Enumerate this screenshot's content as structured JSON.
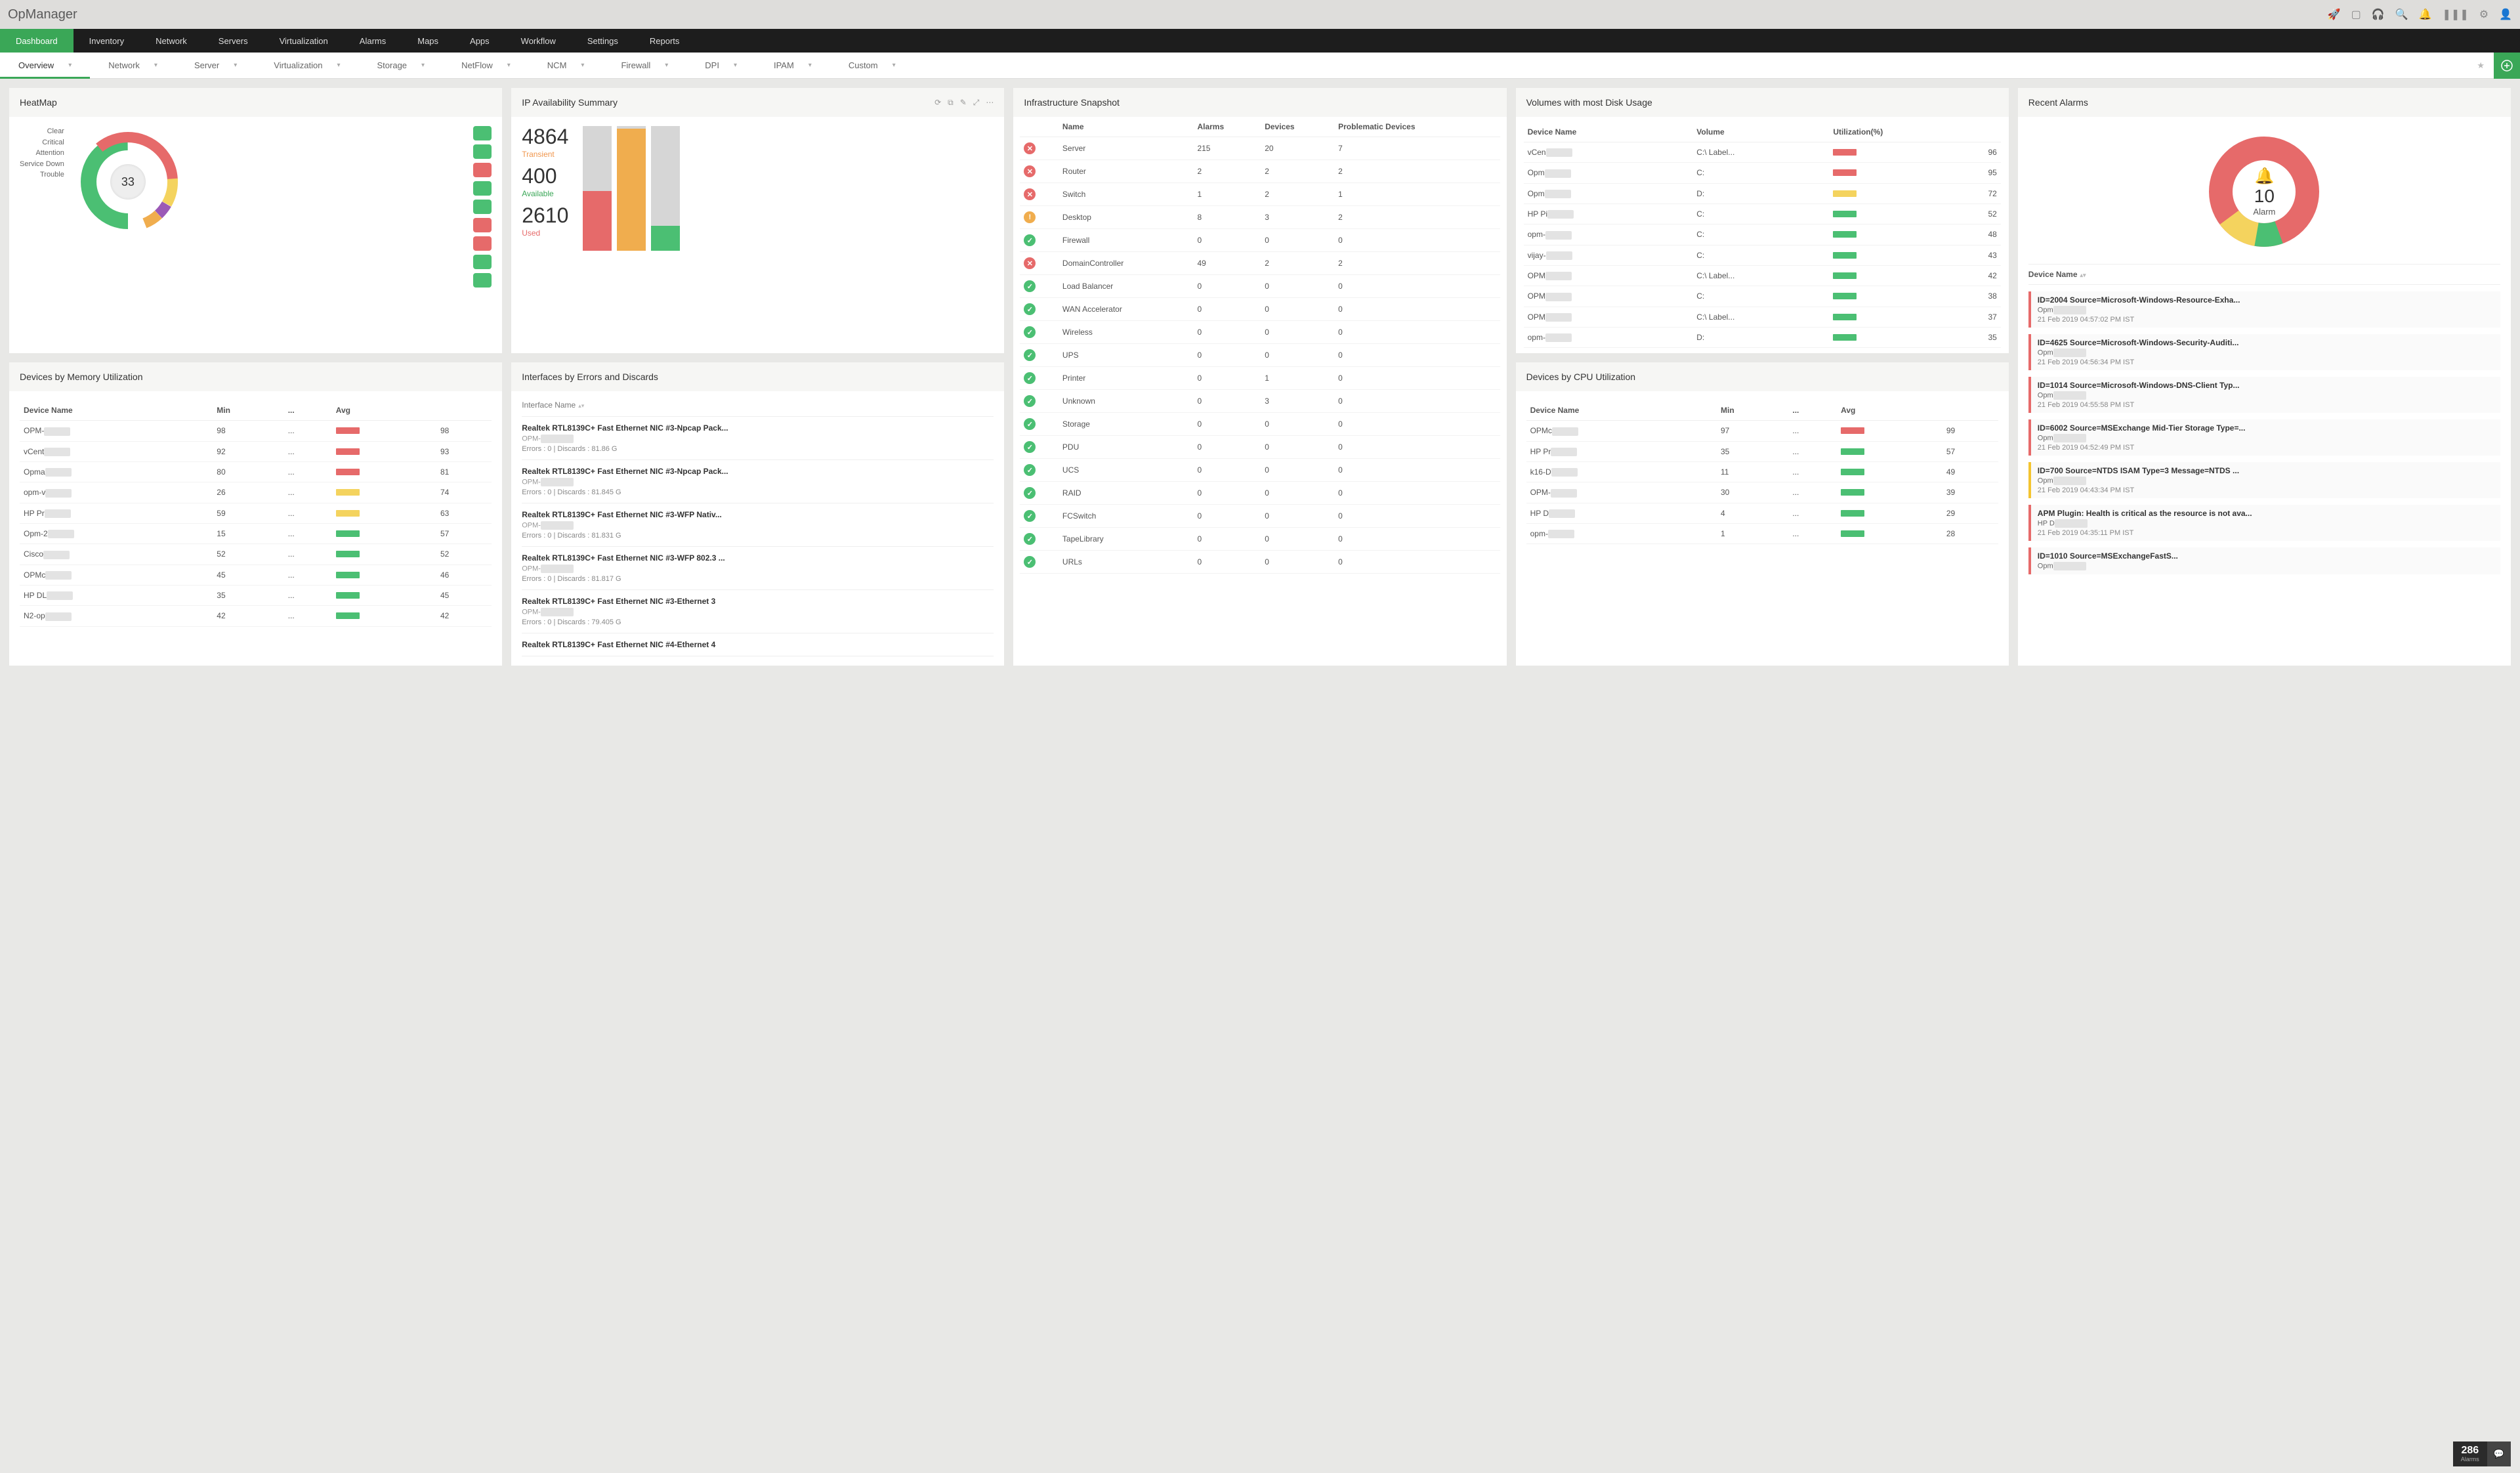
{
  "brand": "OpManager",
  "topIcons": [
    "rocket",
    "presentation",
    "headset",
    "search",
    "bell",
    "barcode",
    "gear",
    "user"
  ],
  "mainnav": [
    "Dashboard",
    "Inventory",
    "Network",
    "Servers",
    "Virtualization",
    "Alarms",
    "Maps",
    "Apps",
    "Workflow",
    "Settings",
    "Reports"
  ],
  "subnav": [
    "Overview",
    "Network",
    "Server",
    "Virtualization",
    "Storage",
    "NetFlow",
    "NCM",
    "Firewall",
    "DPI",
    "IPAM",
    "Custom"
  ],
  "heatmap": {
    "title": "HeatMap",
    "legend": [
      "Clear",
      "Critical",
      "Attention",
      "Service Down",
      "Trouble"
    ],
    "center": "33",
    "tileColors": [
      "g",
      "g",
      "r",
      "g",
      "g",
      "r",
      "r",
      "g",
      "g"
    ]
  },
  "ipAvail": {
    "title": "IP Availability Summary",
    "stats": [
      {
        "value": "4864",
        "label": "Transient",
        "cls": "orange-t"
      },
      {
        "value": "400",
        "label": "Available",
        "cls": "green-t"
      },
      {
        "value": "2610",
        "label": "Used",
        "cls": "red-t"
      }
    ],
    "bars": [
      {
        "fill": 48,
        "color": "#e66a6a"
      },
      {
        "fill": 98,
        "color": "#f0ad4e"
      },
      {
        "fill": 20,
        "color": "#4bbf73"
      }
    ]
  },
  "chart_data": [
    {
      "type": "pie",
      "title": "HeatMap",
      "categories": [
        "Clear",
        "Critical",
        "Attention",
        "Service Down",
        "Trouble"
      ],
      "center_value": 33,
      "notes": "Donut shows device status distribution; exact slice counts not labeled."
    },
    {
      "type": "bar",
      "title": "IP Availability Summary",
      "categories": [
        "Used",
        "Transient",
        "Available"
      ],
      "values": [
        2610,
        4864,
        400
      ],
      "colors": [
        "#e66a6a",
        "#f0ad4e",
        "#4bbf73"
      ]
    },
    {
      "type": "pie",
      "title": "Recent Alarms",
      "center_value": 10,
      "center_label": "Alarm",
      "notes": "Donut of alarm severities; majority red, small green and yellow slices."
    }
  ],
  "memUtil": {
    "title": "Devices by Memory Utilization",
    "headers": [
      "Device Name",
      "Min",
      "...",
      "Avg"
    ],
    "rows": [
      {
        "name": "OPM-",
        "min": "98",
        "avg": "98",
        "color": "#e66a6a"
      },
      {
        "name": "vCent",
        "min": "92",
        "avg": "93",
        "color": "#e66a6a"
      },
      {
        "name": "Opma",
        "min": "80",
        "avg": "81",
        "color": "#e66a6a"
      },
      {
        "name": "opm-v",
        "min": "26",
        "avg": "74",
        "color": "#f4d35e"
      },
      {
        "name": "HP Pr",
        "min": "59",
        "avg": "63",
        "color": "#f4d35e"
      },
      {
        "name": "Opm-2",
        "min": "15",
        "avg": "57",
        "color": "#4bbf73"
      },
      {
        "name": "Cisco",
        "min": "52",
        "avg": "52",
        "color": "#4bbf73"
      },
      {
        "name": "OPMc",
        "min": "45",
        "avg": "46",
        "color": "#4bbf73"
      },
      {
        "name": "HP DL",
        "min": "35",
        "avg": "45",
        "color": "#4bbf73"
      },
      {
        "name": "N2-op",
        "min": "42",
        "avg": "42",
        "color": "#4bbf73"
      }
    ]
  },
  "interfaces": {
    "title": "Interfaces by Errors and Discards",
    "header": "Interface Name",
    "items": [
      {
        "t": "Realtek RTL8139C+ Fast Ethernet NIC #3-Npcap Pack...",
        "d": "OPM-",
        "s": "Errors : 0 | Discards : 81.86 G"
      },
      {
        "t": "Realtek RTL8139C+ Fast Ethernet NIC #3-Npcap Pack...",
        "d": "OPM-",
        "s": "Errors : 0 | Discards : 81.845 G"
      },
      {
        "t": "Realtek RTL8139C+ Fast Ethernet NIC #3-WFP Nativ...",
        "d": "OPM-",
        "s": "Errors : 0 | Discards : 81.831 G"
      },
      {
        "t": "Realtek RTL8139C+ Fast Ethernet NIC #3-WFP 802.3 ...",
        "d": "OPM-",
        "s": "Errors : 0 | Discards : 81.817 G"
      },
      {
        "t": "Realtek RTL8139C+ Fast Ethernet NIC #3-Ethernet 3",
        "d": "OPM-",
        "s": "Errors : 0 | Discards : 79.405 G"
      },
      {
        "t": "Realtek RTL8139C+ Fast Ethernet NIC #4-Ethernet 4",
        "d": "",
        "s": ""
      }
    ]
  },
  "infra": {
    "title": "Infrastructure Snapshot",
    "headers": [
      "",
      "Name",
      "Alarms",
      "Devices",
      "Problematic Devices"
    ],
    "rows": [
      {
        "st": "red",
        "name": "Server",
        "a": "215",
        "d": "20",
        "p": "7"
      },
      {
        "st": "red",
        "name": "Router",
        "a": "2",
        "d": "2",
        "p": "2"
      },
      {
        "st": "red",
        "name": "Switch",
        "a": "1",
        "d": "2",
        "p": "1"
      },
      {
        "st": "orange",
        "name": "Desktop",
        "a": "8",
        "d": "3",
        "p": "2"
      },
      {
        "st": "green",
        "name": "Firewall",
        "a": "0",
        "d": "0",
        "p": "0"
      },
      {
        "st": "red",
        "name": "DomainController",
        "a": "49",
        "d": "2",
        "p": "2"
      },
      {
        "st": "green",
        "name": "Load Balancer",
        "a": "0",
        "d": "0",
        "p": "0"
      },
      {
        "st": "green",
        "name": "WAN Accelerator",
        "a": "0",
        "d": "0",
        "p": "0"
      },
      {
        "st": "green",
        "name": "Wireless",
        "a": "0",
        "d": "0",
        "p": "0"
      },
      {
        "st": "green",
        "name": "UPS",
        "a": "0",
        "d": "0",
        "p": "0"
      },
      {
        "st": "green",
        "name": "Printer",
        "a": "0",
        "d": "1",
        "p": "0"
      },
      {
        "st": "green",
        "name": "Unknown",
        "a": "0",
        "d": "3",
        "p": "0"
      },
      {
        "st": "green",
        "name": "Storage",
        "a": "0",
        "d": "0",
        "p": "0"
      },
      {
        "st": "green",
        "name": "PDU",
        "a": "0",
        "d": "0",
        "p": "0"
      },
      {
        "st": "green",
        "name": "UCS",
        "a": "0",
        "d": "0",
        "p": "0"
      },
      {
        "st": "green",
        "name": "RAID",
        "a": "0",
        "d": "0",
        "p": "0"
      },
      {
        "st": "green",
        "name": "FCSwitch",
        "a": "0",
        "d": "0",
        "p": "0"
      },
      {
        "st": "green",
        "name": "TapeLibrary",
        "a": "0",
        "d": "0",
        "p": "0"
      },
      {
        "st": "green",
        "name": "URLs",
        "a": "0",
        "d": "0",
        "p": "0"
      }
    ]
  },
  "diskUsage": {
    "title": "Volumes with most Disk Usage",
    "headers": [
      "Device Name",
      "Volume",
      "Utilization(%)"
    ],
    "rows": [
      {
        "name": "vCen",
        "vol": "C:\\ Label...",
        "u": "96",
        "color": "#e66a6a"
      },
      {
        "name": "Opm",
        "vol": "C:",
        "u": "95",
        "color": "#e66a6a"
      },
      {
        "name": "Opm",
        "vol": "D:",
        "u": "72",
        "color": "#f4d35e"
      },
      {
        "name": "HP Pi",
        "vol": "C:",
        "u": "52",
        "color": "#4bbf73"
      },
      {
        "name": "opm-",
        "vol": "C:",
        "u": "48",
        "color": "#4bbf73"
      },
      {
        "name": "vijay-",
        "vol": "C:",
        "u": "43",
        "color": "#4bbf73"
      },
      {
        "name": "OPM",
        "vol": "C:\\ Label...",
        "u": "42",
        "color": "#4bbf73"
      },
      {
        "name": "OPM",
        "vol": "C:",
        "u": "38",
        "color": "#4bbf73"
      },
      {
        "name": "OPM",
        "vol": "C:\\ Label...",
        "u": "37",
        "color": "#4bbf73"
      },
      {
        "name": "opm-",
        "vol": "D:",
        "u": "35",
        "color": "#4bbf73"
      }
    ]
  },
  "cpuUtil": {
    "title": "Devices by CPU Utilization",
    "headers": [
      "Device Name",
      "Min",
      "...",
      "Avg"
    ],
    "rows": [
      {
        "name": "OPMc",
        "min": "97",
        "avg": "99",
        "color": "#e66a6a"
      },
      {
        "name": "HP Pr",
        "min": "35",
        "avg": "57",
        "color": "#4bbf73"
      },
      {
        "name": "k16-D",
        "min": "11",
        "avg": "49",
        "color": "#4bbf73"
      },
      {
        "name": "OPM-",
        "min": "30",
        "avg": "39",
        "color": "#4bbf73"
      },
      {
        "name": "HP D",
        "min": "4",
        "avg": "29",
        "color": "#4bbf73"
      },
      {
        "name": "opm-",
        "min": "1",
        "avg": "28",
        "color": "#4bbf73"
      }
    ]
  },
  "recentAlarms": {
    "title": "Recent Alarms",
    "ringValue": "10",
    "ringLabel": "Alarm",
    "listHeader": "Device Name",
    "items": [
      {
        "sev": "red",
        "t": "ID=2004 Source=Microsoft-Windows-Resource-Exha...",
        "d": "Opm",
        "time": "21 Feb 2019 04:57:02 PM IST"
      },
      {
        "sev": "red",
        "t": "ID=4625 Source=Microsoft-Windows-Security-Auditi...",
        "d": "Opm",
        "time": "21 Feb 2019 04:56:34 PM IST"
      },
      {
        "sev": "red",
        "t": "ID=1014 Source=Microsoft-Windows-DNS-Client Typ...",
        "d": "Opm",
        "time": "21 Feb 2019 04:55:58 PM IST"
      },
      {
        "sev": "red",
        "t": "ID=6002 Source=MSExchange Mid-Tier Storage Type=...",
        "d": "Opm",
        "time": "21 Feb 2019 04:52:49 PM IST"
      },
      {
        "sev": "yellow",
        "t": "ID=700 Source=NTDS ISAM Type=3 Message=NTDS ...",
        "d": "Opm",
        "time": "21 Feb 2019 04:43:34 PM IST"
      },
      {
        "sev": "red",
        "t": "APM Plugin: Health is critical as the resource is not ava...",
        "d": "HP D",
        "time": "21 Feb 2019 04:35:11 PM IST"
      },
      {
        "sev": "red",
        "t": "ID=1010 Source=MSExchangeFastS...",
        "d": "Opm",
        "time": ""
      }
    ]
  },
  "alarmsBadge": {
    "count": "286",
    "label": "Alarms"
  }
}
